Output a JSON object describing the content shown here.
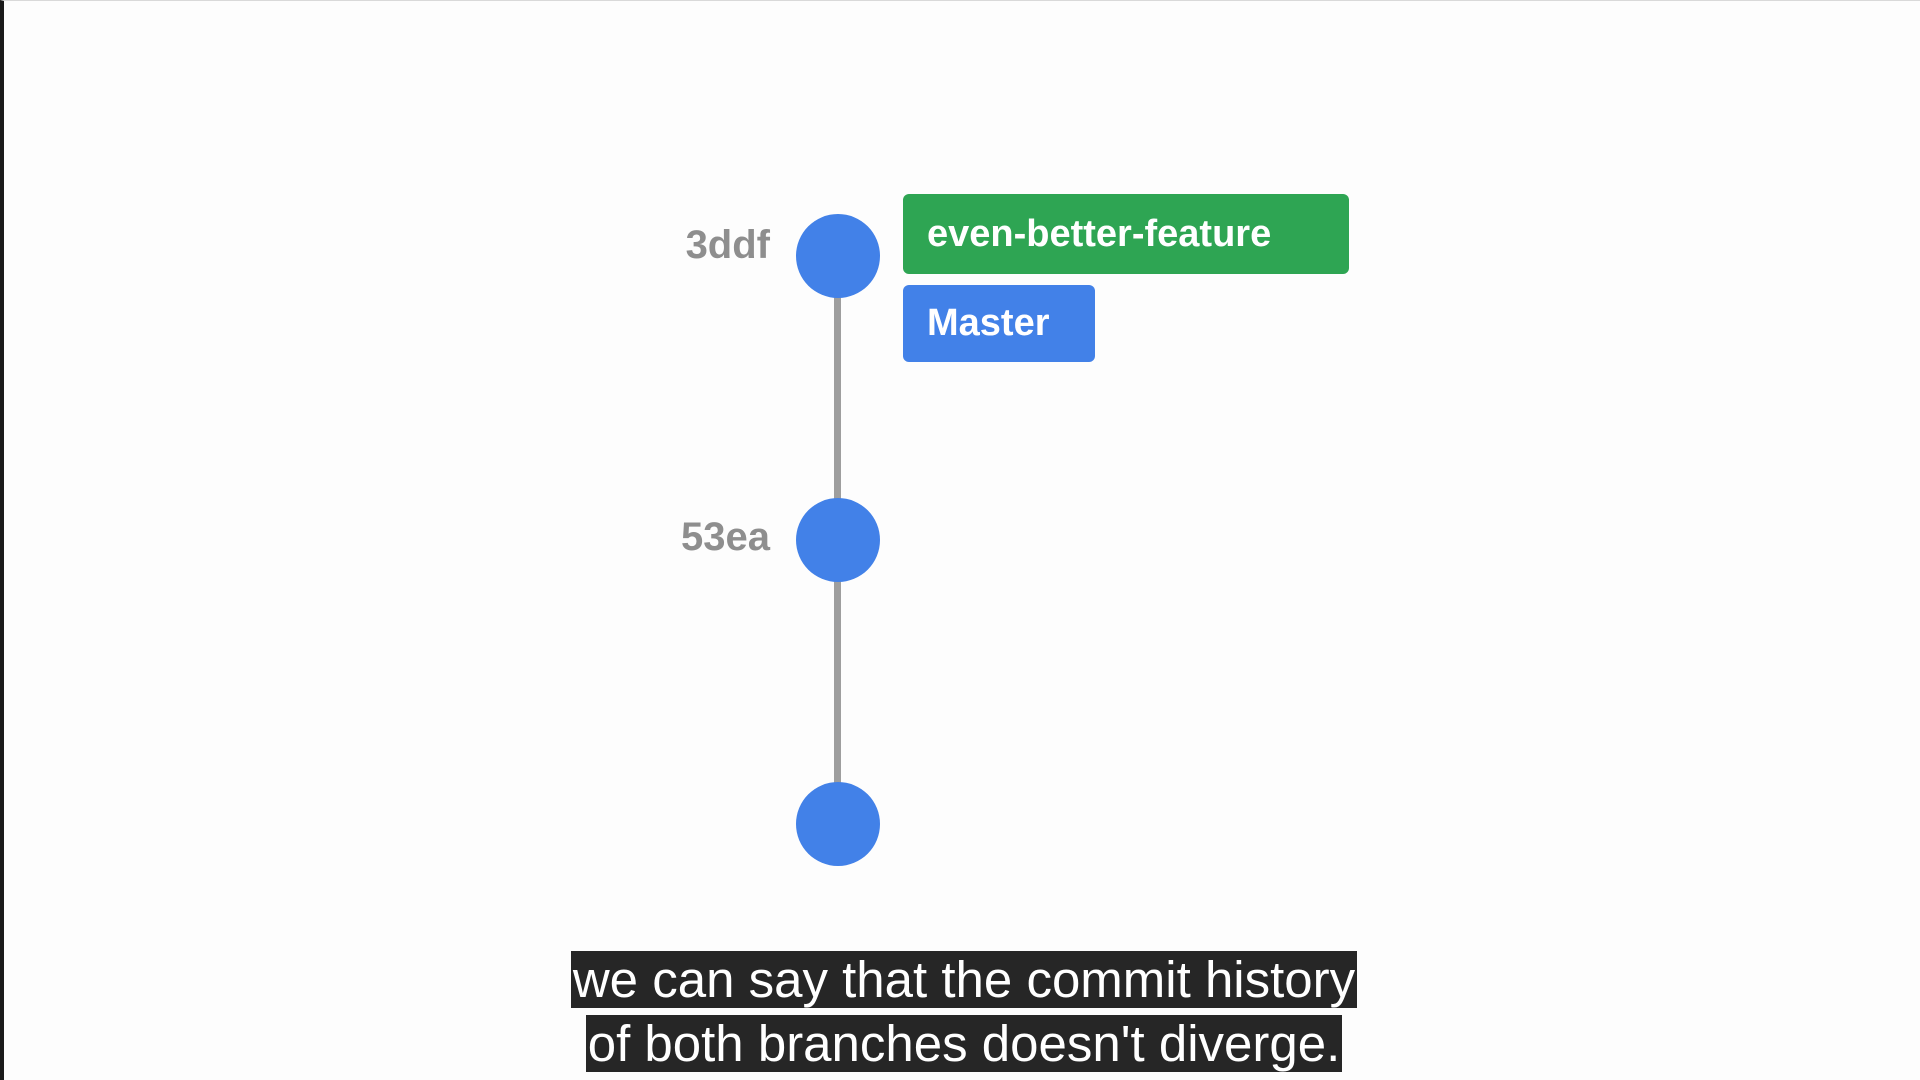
{
  "diagram": {
    "commits": [
      {
        "id": "3ddf"
      },
      {
        "id": "53ea"
      },
      {
        "id": ""
      }
    ],
    "refs": [
      {
        "label": "even-better-feature",
        "color": "#2ea553"
      },
      {
        "label": "Master",
        "color": "#4281e8"
      }
    ],
    "node_color": "#4281e8",
    "line_color": "#9e9e9e"
  },
  "subtitle": {
    "line1": "we can say that the commit history",
    "line2": "of both branches doesn't diverge."
  }
}
